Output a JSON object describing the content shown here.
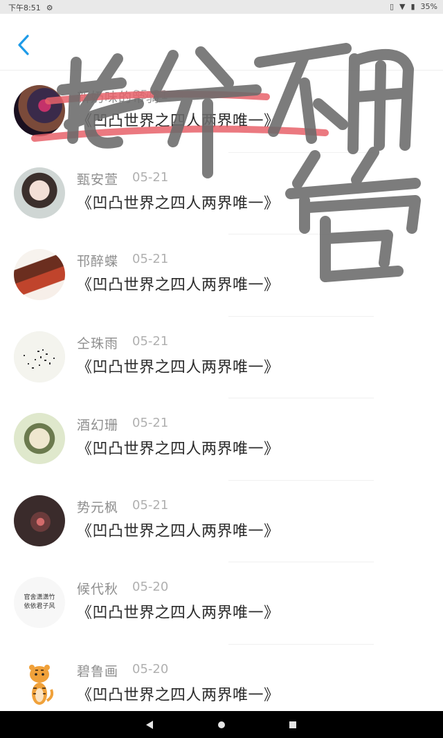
{
  "status_bar": {
    "time": "下午8:51",
    "battery": "35%"
  },
  "conversations": [
    {
      "name": "新奶味的帝骑",
      "date": "05-21",
      "message": "《凹凸世界之四人两界唯一》"
    },
    {
      "name": "甄安萱",
      "date": "05-21",
      "message": "《凹凸世界之四人两界唯一》"
    },
    {
      "name": "邗醉蝶",
      "date": "05-21",
      "message": "《凹凸世界之四人两界唯一》"
    },
    {
      "name": "仝珠雨",
      "date": "05-21",
      "message": "《凹凸世界之四人两界唯一》"
    },
    {
      "name": "酒幻珊",
      "date": "05-21",
      "message": "《凹凸世界之四人两界唯一》"
    },
    {
      "name": "势元枫",
      "date": "05-21",
      "message": "《凹凸世界之四人两界唯一》"
    },
    {
      "name": "候代秋",
      "date": "05-20",
      "message": "《凹凸世界之四人两界唯一》"
    },
    {
      "name": "碧鲁画",
      "date": "05-20",
      "message": "《凹凸世界之四人两界唯一》"
    }
  ],
  "avatar_texts": {
    "row7_line1": "官舍潇潇竹",
    "row7_line2": "依依君子风"
  },
  "watermark_text": "老爷不用管",
  "colors": {
    "accent": "#1e9be8",
    "watermark": "#6b6b6b",
    "strike": "#e8626a"
  }
}
